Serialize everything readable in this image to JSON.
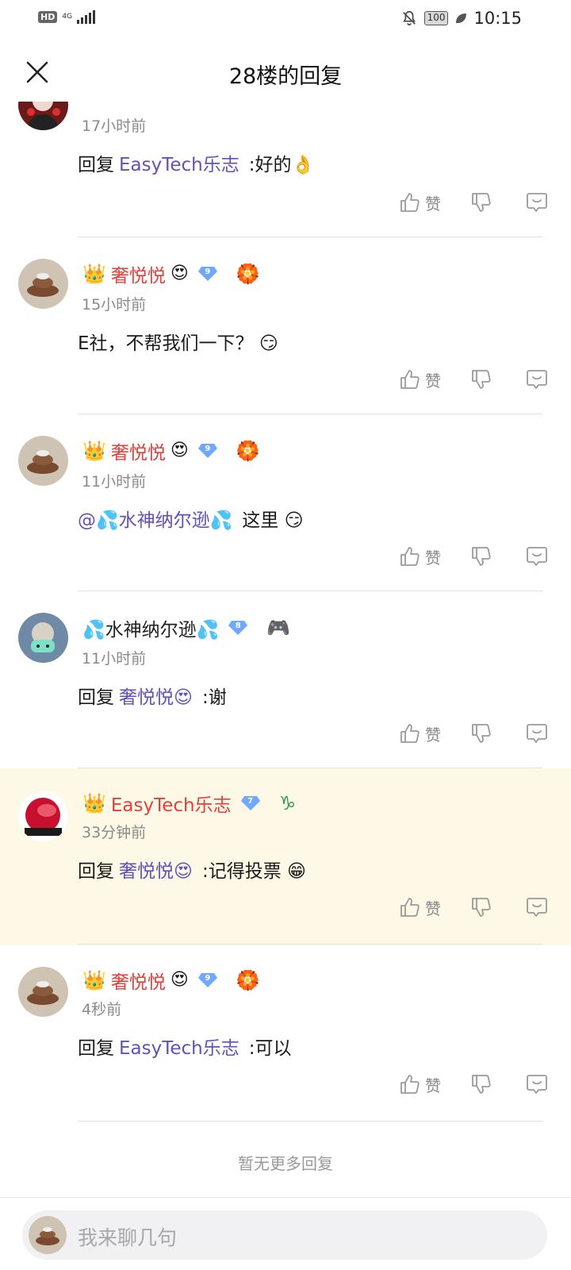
{
  "status_bar": {
    "hd": "HD",
    "network": "4G",
    "battery": "100",
    "time": "10:15"
  },
  "header": {
    "title": "28楼的回复"
  },
  "actions": {
    "like_label": "赞"
  },
  "comments": [
    {
      "user": "",
      "time": "17小时前",
      "reply_prefix": "回复",
      "mention": "EasyTech乐志",
      "text": ":好的👌"
    },
    {
      "user": "奢悦悦",
      "user_emoji": "😍",
      "level": "9",
      "medal": "🏵️",
      "time": "15小时前",
      "text": "E社，不帮我们一下？ 😏"
    },
    {
      "user": "奢悦悦",
      "user_emoji": "😍",
      "level": "9",
      "medal": "🏵️",
      "time": "11小时前",
      "mention": "@💦水神纳尔逊💦",
      "text": "这里 😏"
    },
    {
      "user": "💦水神纳尔逊💦",
      "level": "8",
      "medal": "🎮",
      "time": "11小时前",
      "reply_prefix": "回复",
      "mention": "奢悦悦😍",
      "text": ":谢"
    },
    {
      "user": "EasyTech乐志",
      "level": "7",
      "medal": "♑",
      "time": "33分钟前",
      "reply_prefix": "回复",
      "mention": "奢悦悦😍",
      "text": ":记得投票 😁"
    },
    {
      "user": "奢悦悦",
      "user_emoji": "😍",
      "level": "9",
      "medal": "🏵️",
      "time": "4秒前",
      "reply_prefix": "回复",
      "mention": "EasyTech乐志",
      "text": ":可以"
    }
  ],
  "footer": {
    "no_more": "暂无更多回复"
  },
  "composer": {
    "placeholder": "我来聊几句"
  },
  "colors": {
    "username_red": "#e0413a",
    "mention_purple": "#5f52b8",
    "highlight_bg": "#fdf9e6",
    "level_badge_blue": "#6ea8ff"
  }
}
